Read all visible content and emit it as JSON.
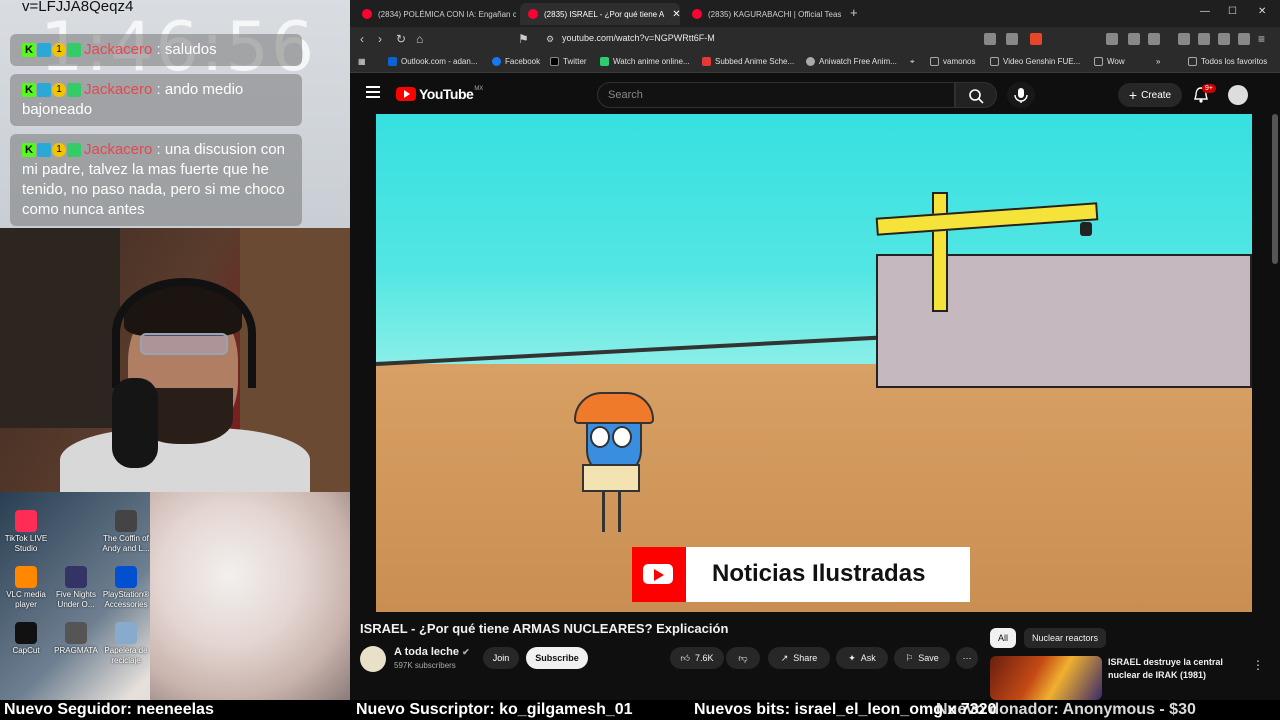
{
  "stream": {
    "url_fragment": "v=LFJJA8Qeqz4",
    "clock": "1:46:56",
    "chat": [
      {
        "user": "Jackacero",
        "text": ": saludos"
      },
      {
        "user": "Jackacero",
        "text": ": ando medio bajoneado"
      },
      {
        "user": "Jackacero",
        "text": ": una discusion con mi padre, talvez la mas fuerte que he tenido, no paso nada, pero si me choco como nunca antes"
      }
    ],
    "desktop_icons": [
      {
        "label": "TikTok LIVE Studio",
        "color": "#ff2d55"
      },
      {
        "label": "The Coffin of Andy and L...",
        "color": "#444444"
      },
      {
        "label": "VLC media player",
        "color": "#ff8800"
      },
      {
        "label": "Five Nights Under O...",
        "color": "#333366"
      },
      {
        "label": "PlayStation® Accessories",
        "color": "#0050d0"
      },
      {
        "label": "CapCut",
        "color": "#111111"
      },
      {
        "label": "PRAGMATA",
        "color": "#555555"
      },
      {
        "label": "Papelera de reciclaje",
        "color": "#88aacc"
      }
    ]
  },
  "browser": {
    "tabs": [
      {
        "label": "(2834) POLÉMICA CON IA: Engañan c",
        "active": false
      },
      {
        "label": "(2835) ISRAEL - ¿Por qué tiene A",
        "active": true
      },
      {
        "label": "(2835) KAGURABACHI | Official Teas",
        "active": false
      }
    ],
    "url": "youtube.com/watch?v=NGPWRtt6F-M",
    "bookmarks": [
      {
        "label": "Outlook.com - adan...",
        "color": "#0a64d6"
      },
      {
        "label": "Facebook",
        "color": "#1877f2"
      },
      {
        "label": "Twitter",
        "color": "#000000"
      },
      {
        "label": "Watch anime online...",
        "color": "#2ecc71"
      },
      {
        "label": "Subbed Anime Sche...",
        "color": "#e53935"
      },
      {
        "label": "Aniwatch Free Anim...",
        "color": "#aaaaaa"
      },
      {
        "label": "vamonos",
        "color": "#888888"
      },
      {
        "label": "Video Genshin FUE...",
        "color": "#888888"
      },
      {
        "label": "Wow",
        "color": "#888888"
      },
      {
        "label": "Todos los favoritos",
        "color": "#888888"
      }
    ]
  },
  "youtube": {
    "logo_text": "YouTube",
    "region": "MX",
    "search_placeholder": "Search",
    "create_label": "Create",
    "notifications": "9+",
    "video_banner": "Noticias Ilustradas",
    "title": "ISRAEL - ¿Por qué tiene ARMAS NUCLEARES? Explicación",
    "channel": "A toda leche",
    "subscribers": "597K subscribers",
    "join_label": "Join",
    "subscribe_label": "Subscribe",
    "likes": "7.6K",
    "share_label": "Share",
    "ask_label": "Ask",
    "save_label": "Save",
    "chips": [
      "All",
      "Nuclear reactors"
    ],
    "recommended": {
      "title": "ISRAEL destruye la central nuclear de IRAK (1981)"
    }
  },
  "ticker": {
    "follower": "Nuevo Seguidor: neeneelas",
    "subscriber": "Nuevo Suscriptor: ko_gilgamesh_01",
    "bits": "Nuevos bits: israel_el_leon_omg x 7320",
    "donor": "Nuevo donador: Anonymous - $30"
  }
}
